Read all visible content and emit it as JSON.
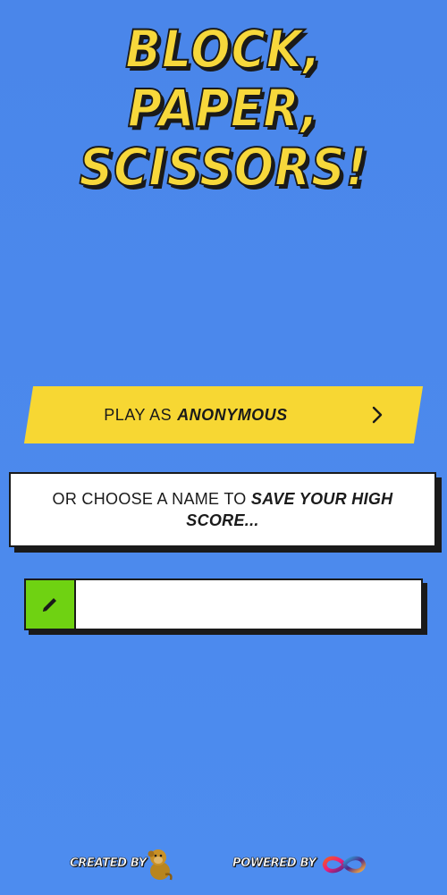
{
  "title": {
    "line1": "BLOCK, PAPER,",
    "line2": "SCISSORS!"
  },
  "play_button": {
    "prefix": "PLAY AS",
    "emphasis": "ANONYMOUS",
    "icon": "chevron-right-icon"
  },
  "prompt": {
    "text": "OR CHOOSE A NAME TO",
    "emphasis": "SAVE YOUR HIGH SCORE..."
  },
  "name_field": {
    "value": "",
    "placeholder": "",
    "icon": "pencil-icon"
  },
  "footer": {
    "created_by": "CREATED BY",
    "powered_by": "POWERED BY",
    "avatar_icon": "monkey-avatar-icon",
    "logo_icon": "infinity-logo-icon"
  },
  "colors": {
    "background": "#4a86ea",
    "accent_yellow": "#f7d733",
    "pencil_green": "#6fd212",
    "outline": "#1a1a1a"
  }
}
